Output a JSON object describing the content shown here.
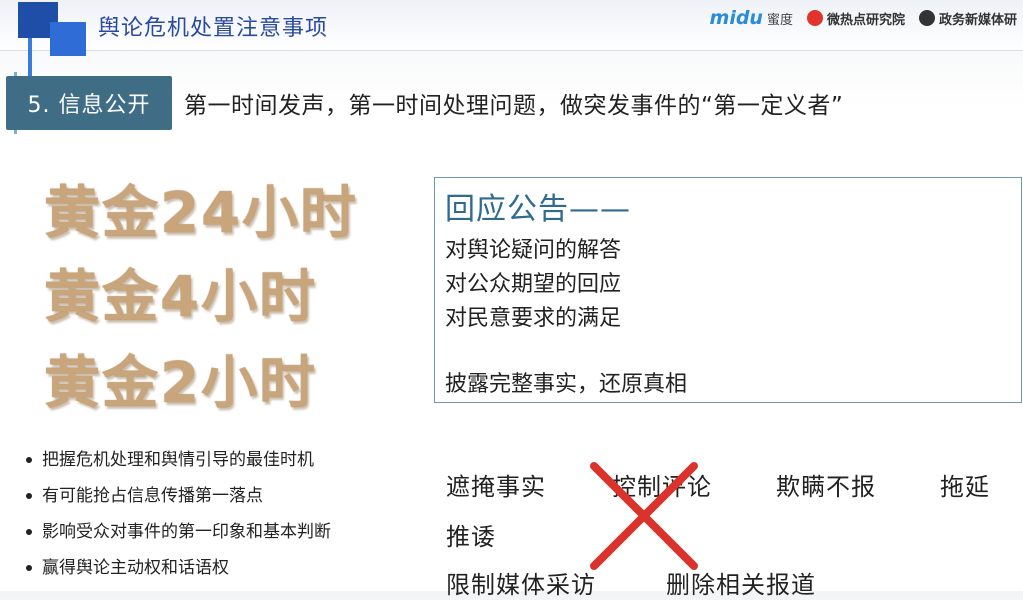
{
  "header": {
    "title": "舆论危机处置注意事项",
    "brands": [
      {
        "mark": "midu",
        "sub": "蜜度",
        "icon": "midu-logo-icon"
      },
      {
        "label": "微热点研究院",
        "icon": "weibo-eye-icon"
      },
      {
        "label": "政务新媒体研",
        "icon": "gov-media-icon"
      }
    ]
  },
  "section": {
    "tag": "5. 信息公开",
    "description": "第一时间发声，第一时间处理问题，做突发事件的“第一定义者”"
  },
  "golden_hours": [
    "黄金24小时",
    "黄金4小时",
    "黄金2小时"
  ],
  "response": {
    "heading": "回应公告——",
    "lines": [
      "对舆论疑问的解答",
      "对公众期望的回应",
      "对民意要求的满足",
      "披露完整事实，还原真相"
    ]
  },
  "bullets": [
    "把握危机处理和舆情引导的最佳时机",
    "有可能抢占信息传播第一落点",
    "影响受众对事件的第一印象和基本判断",
    "赢得舆论主动权和话语权"
  ],
  "bad_practices": [
    "遮掩事实",
    "控制评论",
    "欺瞒不报",
    "拖延",
    "推诿",
    "限制媒体采访",
    "删除相关报道"
  ],
  "colors": {
    "accent_blue": "#2a4aa0",
    "tag_bg": "#3f6d86",
    "gold": "#c9a57c",
    "cross_red": "#d9332b",
    "box_border": "#6a9ab6"
  }
}
